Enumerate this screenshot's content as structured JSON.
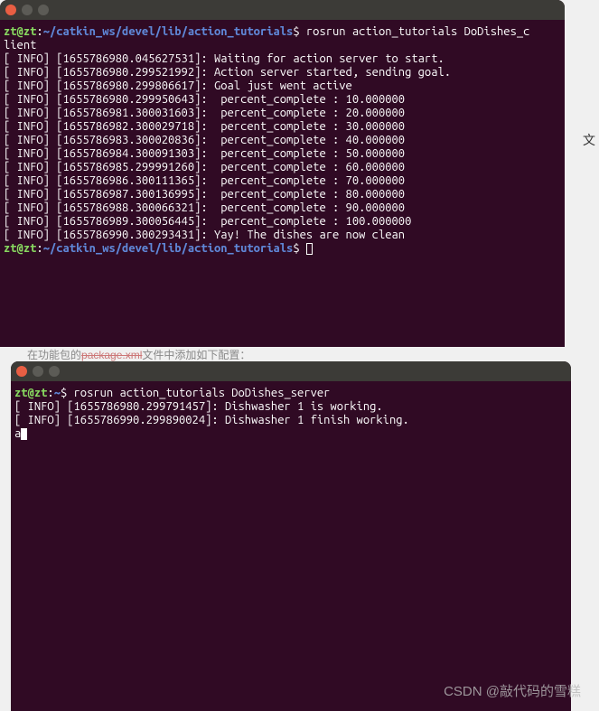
{
  "terminal1": {
    "prompt_user": "zt@zt",
    "prompt_sep1": ":",
    "prompt_path": "~/catkin_ws/devel/lib/action_tutorials",
    "prompt_sep2": "$",
    "command": "rosrun action_tutorials DoDishes_c",
    "command_wrap": "lient",
    "lines": [
      "[ INFO] [1655786980.045627531]: Waiting for action server to start.",
      "[ INFO] [1655786980.299521992]: Action server started, sending goal.",
      "[ INFO] [1655786980.299806617]: Goal just went active",
      "[ INFO] [1655786980.299950643]:  percent_complete : 10.000000",
      "[ INFO] [1655786981.300031603]:  percent_complete : 20.000000",
      "[ INFO] [1655786982.300029718]:  percent_complete : 30.000000",
      "[ INFO] [1655786983.300020836]:  percent_complete : 40.000000",
      "[ INFO] [1655786984.300091303]:  percent_complete : 50.000000",
      "[ INFO] [1655786985.299991260]:  percent_complete : 60.000000",
      "[ INFO] [1655786986.300111365]:  percent_complete : 70.000000",
      "[ INFO] [1655786987.300136995]:  percent_complete : 80.000000",
      "[ INFO] [1655786988.300066321]:  percent_complete : 90.000000",
      "[ INFO] [1655786989.300056445]:  percent_complete : 100.000000",
      "[ INFO] [1655786990.300293431]: Yay! The dishes are now clean"
    ]
  },
  "terminal2": {
    "prompt_user": "zt@zt",
    "prompt_sep1": ":",
    "prompt_path": "~",
    "prompt_sep2": "$",
    "command": "rosrun action_tutorials DoDishes_server",
    "lines": [
      "[ INFO] [1655786980.299791457]: Dishwasher 1 is working.",
      "[ INFO] [1655786990.299890024]: Dishwasher 1 finish working."
    ],
    "input_char": "a"
  },
  "bg_text_prefix": "在功能包的",
  "bg_text_link": "package.xml",
  "bg_text_suffix": "文件中添加如下配置：",
  "edge_char": "文",
  "watermark": "CSDN @敲代码的雪糕"
}
